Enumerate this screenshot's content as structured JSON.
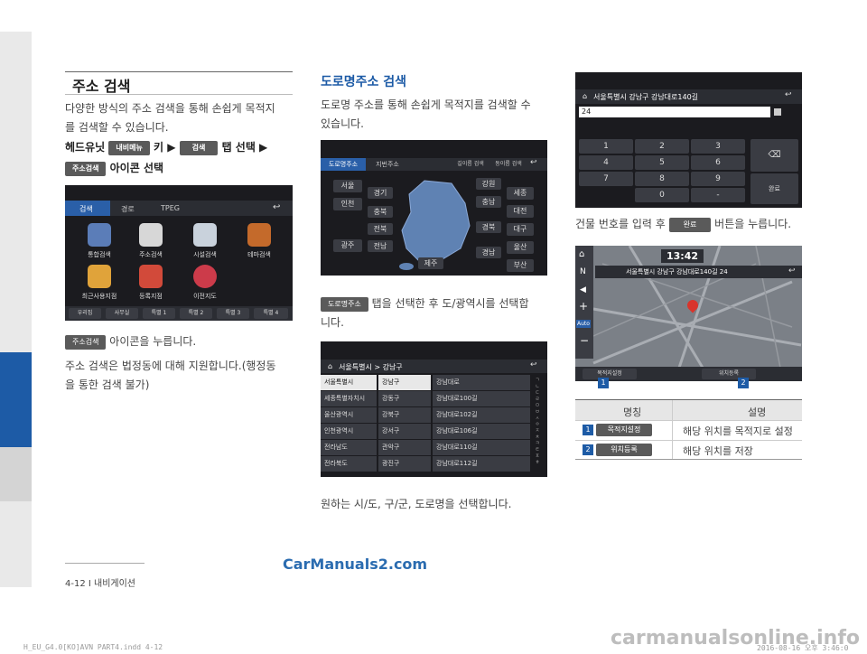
{
  "left": {
    "title": "주소 검색",
    "intro_line1": "다양한 방식의 주소 검색을 통해 손쉽게 목적지",
    "intro_line2": "를 검색할 수 있습니다.",
    "path_headunit": "헤드유닛",
    "chip_nav_menu": "내비메뉴",
    "path_key": "키 ▶",
    "chip_search": "검색",
    "path_tab": "탭 선택 ▶",
    "chip_address_search": "주소검색",
    "path_icon": "아이콘 선택",
    "screen1": {
      "tabs": [
        "검색",
        "경로",
        "TPEG"
      ],
      "tiles": [
        "통합검색",
        "주소검색",
        "시설검색",
        "테마검색",
        "최근사용지점",
        "등록지점",
        "이전지도"
      ],
      "favs": [
        "우리집",
        "사무실",
        "특별 1",
        "특별 2",
        "특별 3",
        "특별 4"
      ]
    },
    "chip_press": "주소검색",
    "press_text": "아이콘을 누릅니다.",
    "note_line1": "주소 검색은 법정동에 대해 지원합니다.(행정동",
    "note_line2": "을 통한 검색 불가)"
  },
  "middle": {
    "title": "도로명주소 검색",
    "intro_line1": "도로명 주소를 통해 손쉽게 목적지를 검색할 수",
    "intro_line2": "있습니다.",
    "screen2": {
      "tabs": [
        "도로명주소",
        "지번주소"
      ],
      "right_tabs": [
        "길이름 검색",
        "동이름 검색"
      ],
      "left_regions": [
        "서울",
        "인천",
        "경기",
        "충북",
        "전북",
        "광주",
        "전남"
      ],
      "right_regions": [
        "강원",
        "세종",
        "충남",
        "대전",
        "경북",
        "대구",
        "경남",
        "울산",
        "부산"
      ],
      "bottom_region": "제주"
    },
    "chip_roadname": "도로명주소",
    "step_line1": "탭을 선택한 후 도/광역시를 선택합",
    "step_line2": "니다.",
    "screen3": {
      "header": "서울특별시 > 강남구",
      "col1": [
        "서울특별시",
        "세종특별자치시",
        "울산광역시",
        "인천광역시",
        "전라남도",
        "전라북도"
      ],
      "col2": [
        "강남구",
        "강동구",
        "강북구",
        "강서구",
        "관악구",
        "광진구"
      ],
      "col3": [
        "강남대로",
        "강남대로100길",
        "강남대로102길",
        "강남대로106길",
        "강남대로110길",
        "강남대로112길"
      ]
    },
    "caption": "원하는 시/도, 구/군, 도로명을 선택합니다."
  },
  "right": {
    "screen4": {
      "header": "서울특별시 강남구 강남대로140길",
      "input_value": "24",
      "keys": [
        "1",
        "2",
        "3",
        "4",
        "5",
        "6",
        "7",
        "8",
        "9",
        "0",
        "-"
      ],
      "done": "완료"
    },
    "input_text_pre": "건물 번호를 입력 후",
    "chip_done": "완료",
    "input_text_post": "버튼을 누릅니다.",
    "screen5": {
      "time": "13:42",
      "address": "서울특별시 강남구 강남대로140길 24",
      "set_dest": "목적지설정",
      "register": "위치등록",
      "auto": "Auto",
      "badge1": "1",
      "badge2": "2"
    },
    "table": {
      "head_name": "명칭",
      "head_desc": "설명",
      "rows": [
        {
          "num": "1",
          "name": "목적지설정",
          "desc": "해당 위치를 목적지로 설정"
        },
        {
          "num": "2",
          "name": "위치등록",
          "desc": "해당 위치를 저장"
        }
      ]
    }
  },
  "footer": {
    "page": "4-12 I 내비게이션",
    "watermark_center": "CarManuals2.com",
    "file_info": "H_EU_G4.0[KO]AVN PART4.indd   4-12",
    "date_info": "2016-08-16   오후 3:46:0",
    "watermark_right": "carmanualsonline.info"
  },
  "colors": {
    "accent": "#1d5ba6",
    "screen_bg": "#1b1b1f"
  }
}
